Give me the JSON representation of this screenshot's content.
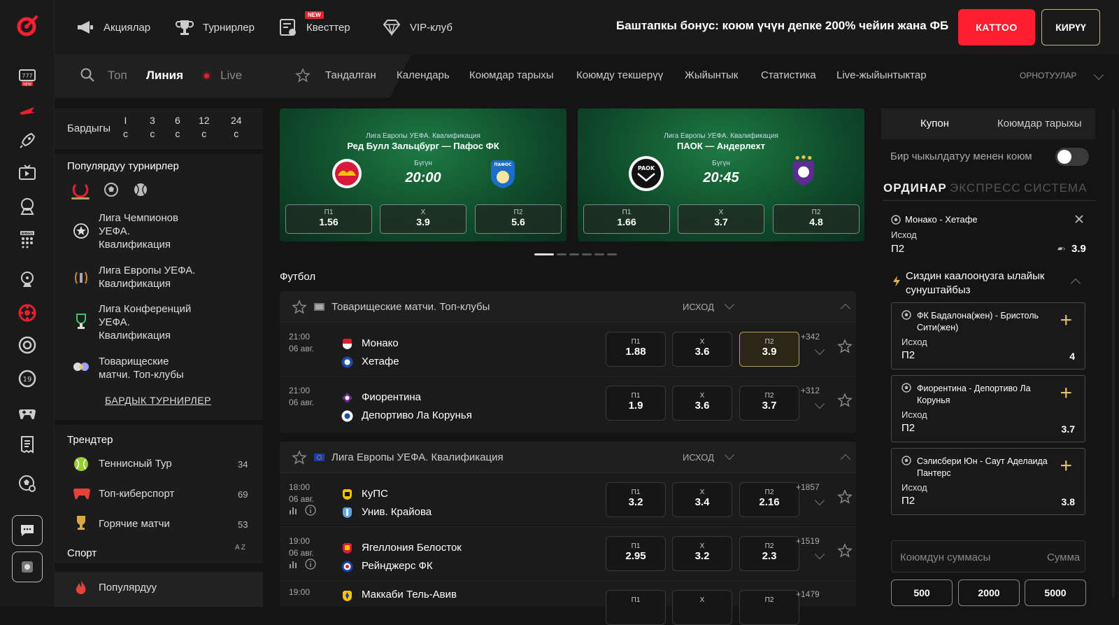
{
  "topnav": {
    "items": [
      "Акциялар",
      "Турнирлер",
      "Квесттер",
      "VIP-клуб"
    ],
    "new_badge": "NEW",
    "bonus": "Баштапкы бонус: коюм үчүн депке 200% чейин жана ФБ",
    "register": "КАТТОО",
    "login": "КИРҮҮ"
  },
  "rail": {
    "new_badge": "NEW",
    "bingo_label": "BINGO"
  },
  "modes": {
    "top": "Топ",
    "line": "Линия",
    "live": "Live"
  },
  "subnav": [
    "Тандалган",
    "Календарь",
    "Коюмдар тарыхы",
    "Коюмду текшерүү",
    "Жыйынтык",
    "Статистика",
    "Live-жыйынтыктар"
  ],
  "settings_label": "ОРНОТУУЛАР",
  "filters": {
    "all": "Бардыгы",
    "cols": [
      [
        "I",
        "с"
      ],
      [
        "3",
        "с"
      ],
      [
        "6",
        "с"
      ],
      [
        "12",
        "с"
      ],
      [
        "24",
        "с"
      ]
    ]
  },
  "popular": {
    "title": "Популярдуу турнирлер",
    "items": [
      [
        "Лига Чемпионов",
        "УЕФА.",
        "Квалификация"
      ],
      [
        "Лига Европы УЕФА.",
        "Квалификация"
      ],
      [
        "Лига Конференций",
        "УЕФА.",
        "Квалификация"
      ],
      [
        "Товарищеские",
        "матчи. Топ-клубы"
      ]
    ],
    "all_link": "БАРДЫК ТУРНИРЛЕР"
  },
  "trends": {
    "title": "Трендтер",
    "items": [
      {
        "name": "Теннисный Тур",
        "count": "34"
      },
      {
        "name": "Топ-киберспорт",
        "count": "69"
      },
      {
        "name": "Горячие матчи",
        "count": "53"
      }
    ]
  },
  "sport": {
    "title": "Спорт",
    "sort": "A Z",
    "popular": "Популярдуу"
  },
  "banners": [
    {
      "league": "Лига Европы УЕФА. Квалификация",
      "team1": "Ред Булл Зальцбург",
      "dash": "—",
      "team2": "Пафос ФК",
      "today": "Бүгүн",
      "time": "20:00",
      "odds": [
        {
          "l": "П1",
          "v": "1.56"
        },
        {
          "l": "Х",
          "v": "3.9"
        },
        {
          "l": "П2",
          "v": "5.6"
        }
      ]
    },
    {
      "league": "Лига Европы УЕФА. Квалификация",
      "team1": "ПАОК",
      "dash": "—",
      "team2": "Андерлехт",
      "today": "Бүгүн",
      "time": "20:45",
      "odds": [
        {
          "l": "П1",
          "v": "1.66"
        },
        {
          "l": "Х",
          "v": "3.7"
        },
        {
          "l": "П2",
          "v": "4.8"
        }
      ]
    }
  ],
  "banner_logos": {
    "paok": "PAOK",
    "pafos": "ПАФОС"
  },
  "section_title": "Футбол",
  "groups": [
    {
      "title": "Товарищеские матчи. Топ-клубы",
      "market": "ИСХОД",
      "matches": [
        {
          "time": "21:00",
          "date": "06 авг.",
          "t1": "Монако",
          "t2": "Хетафе",
          "odds": [
            {
              "l": "П1",
              "v": "1.88"
            },
            {
              "l": "Х",
              "v": "3.6"
            },
            {
              "l": "П2",
              "v": "3.9"
            }
          ],
          "more": "+342"
        },
        {
          "time": "21:00",
          "date": "06 авг.",
          "t1": "Фиорентина",
          "t2": "Депортиво Ла Корунья",
          "odds": [
            {
              "l": "П1",
              "v": "1.9"
            },
            {
              "l": "Х",
              "v": "3.6"
            },
            {
              "l": "П2",
              "v": "3.7"
            }
          ],
          "more": "+312"
        }
      ]
    },
    {
      "title": "Лига Европы УЕФА. Квалификация",
      "market": "ИСХОД",
      "matches": [
        {
          "time": "18:00",
          "date": "06 авг.",
          "t1": "КуПС",
          "t2": "Унив. Крайова",
          "odds": [
            {
              "l": "П1",
              "v": "3.2"
            },
            {
              "l": "Х",
              "v": "3.4"
            },
            {
              "l": "П2",
              "v": "2.16"
            }
          ],
          "more": "+1857"
        },
        {
          "time": "19:00",
          "date": "06 авг.",
          "t1": "Ягеллония Белосток",
          "t2": "Рейнджерс ФК",
          "odds": [
            {
              "l": "П1",
              "v": "2.95"
            },
            {
              "l": "Х",
              "v": "3.2"
            },
            {
              "l": "П2",
              "v": "2.3"
            }
          ],
          "more": "+1519"
        },
        {
          "time": "19:00",
          "date": "",
          "t1": "Маккаби Тель-Авив",
          "t2": "",
          "odds": [
            {
              "l": "П1",
              "v": ""
            },
            {
              "l": "Х",
              "v": ""
            },
            {
              "l": "П2",
              "v": ""
            }
          ],
          "more": "+1479"
        }
      ]
    }
  ],
  "coupon": {
    "tab1": "Купон",
    "tab2": "Коюмдар тарыхы",
    "oneclick": "Бир чыкылдатуу менен коюм",
    "types": [
      "ОРДИНАР",
      "ЭКСПРЕСС",
      "СИСТЕМА"
    ],
    "selected": {
      "teams": "Монако - Хетафе",
      "res": "Исход",
      "pick": "П2",
      "coef": "3.9"
    },
    "suggest_title": "Сиздин каалооңузга ылайык сунуштайбыз",
    "suggestions": [
      {
        "teams": "ФК Бадалона(жен) - Бристоль Сити(жен)",
        "res": "Исход",
        "pick": "П2",
        "coef": "4"
      },
      {
        "teams": "Фиорентина - Депортиво Ла Корунья",
        "res": "Исход",
        "pick": "П2",
        "coef": "3.7"
      },
      {
        "teams": "Сэлисбери Юн - Саут Аделаида Пантерс",
        "res": "Исход",
        "pick": "П2",
        "coef": "3.8"
      }
    ],
    "amount_placeholder": "Коюмдун суммасы",
    "amount_right": "Сумма",
    "amounts": [
      "500",
      "2000",
      "5000"
    ]
  },
  "colors": {
    "accent": "#ff1f31",
    "gold": "#c9b37a",
    "bg": "#141414"
  }
}
